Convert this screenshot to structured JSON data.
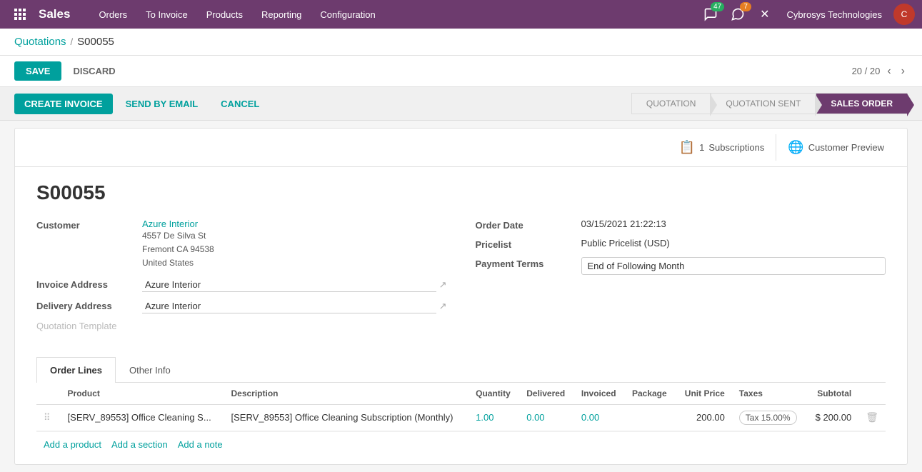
{
  "topnav": {
    "app_grid_icon": "⊞",
    "brand": "Sales",
    "menu_items": [
      "Orders",
      "To Invoice",
      "Products",
      "Reporting",
      "Configuration"
    ],
    "badge_messages": "47",
    "badge_chat": "7",
    "company_name": "Cybrosys Technologies"
  },
  "breadcrumb": {
    "parent_label": "Quotations",
    "separator": "/",
    "current": "S00055"
  },
  "toolbar": {
    "save_label": "SAVE",
    "discard_label": "DISCARD",
    "pagination": "20 / 20"
  },
  "action_buttons": {
    "create_invoice": "CREATE INVOICE",
    "send_by_email": "SEND BY EMAIL",
    "cancel": "CANCEL"
  },
  "status_steps": [
    {
      "label": "QUOTATION",
      "active": false
    },
    {
      "label": "QUOTATION SENT",
      "active": false
    },
    {
      "label": "SALES ORDER",
      "active": true
    }
  ],
  "doc_actions": {
    "subscriptions_icon": "📋",
    "subscriptions_count": "1",
    "subscriptions_label": "Subscriptions",
    "preview_icon": "🌐",
    "preview_label": "Customer Preview"
  },
  "order": {
    "number": "S00055",
    "customer_label": "Customer",
    "customer_name": "Azure Interior",
    "customer_address1": "4557 De Silva St",
    "customer_address2": "Fremont CA 94538",
    "customer_address3": "United States",
    "invoice_address_label": "Invoice Address",
    "invoice_address_value": "Azure Interior",
    "delivery_address_label": "Delivery Address",
    "delivery_address_value": "Azure Interior",
    "quotation_template_label": "Quotation Template",
    "order_date_label": "Order Date",
    "order_date_value": "03/15/2021 21:22:13",
    "pricelist_label": "Pricelist",
    "pricelist_value": "Public Pricelist (USD)",
    "payment_terms_label": "Payment Terms",
    "payment_terms_value": "End of Following Month"
  },
  "tabs": [
    {
      "label": "Order Lines",
      "active": true
    },
    {
      "label": "Other Info",
      "active": false
    }
  ],
  "table": {
    "columns": [
      "Product",
      "Description",
      "Quantity",
      "Delivered",
      "Invoiced",
      "Package",
      "Unit Price",
      "Taxes",
      "Subtotal"
    ],
    "rows": [
      {
        "product": "[SERV_89553] Office Cleaning S...",
        "description": "[SERV_89553] Office Cleaning Subscription (Monthly)",
        "quantity": "1.00",
        "delivered": "0.00",
        "invoiced": "0.00",
        "package": "",
        "unit_price": "200.00",
        "taxes": "Tax 15.00%",
        "subtotal": "$ 200.00"
      }
    ],
    "footer_links": [
      "Add a product",
      "Add a section",
      "Add a note"
    ]
  }
}
